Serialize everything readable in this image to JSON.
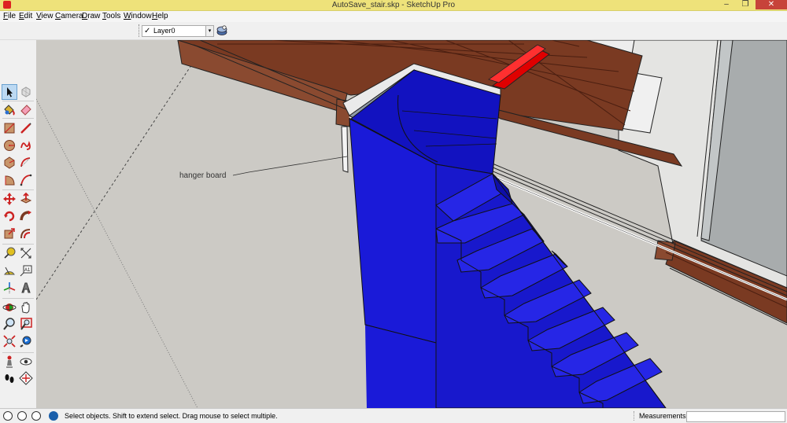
{
  "window": {
    "title": "AutoSave_stair.skp - SketchUp Pro",
    "minimize": "–",
    "maximize": "❐",
    "close": "✕"
  },
  "menu": [
    {
      "key": "F",
      "rest": "ile"
    },
    {
      "key": "E",
      "rest": "dit"
    },
    {
      "key": "V",
      "rest": "iew"
    },
    {
      "key": "C",
      "rest": "amera"
    },
    {
      "key": "D",
      "rest": "raw"
    },
    {
      "key": "T",
      "rest": "ools"
    },
    {
      "key": "W",
      "rest": "indow"
    },
    {
      "key": "H",
      "rest": "elp"
    }
  ],
  "layers": {
    "current": "Layer0",
    "check": "✓",
    "dropdown_arrow": "▾"
  },
  "tools": [
    {
      "name": "select-tool-icon",
      "selected": true
    },
    {
      "name": "make-component-icon"
    },
    {
      "name": "paint-bucket-icon"
    },
    {
      "name": "eraser-icon"
    },
    {
      "name": "rectangle-icon"
    },
    {
      "name": "line-icon"
    },
    {
      "name": "circle-icon"
    },
    {
      "name": "freehand-icon"
    },
    {
      "name": "polygon-icon"
    },
    {
      "name": "arc-icon"
    },
    {
      "name": "pie-icon"
    },
    {
      "name": "two-point-arc-icon"
    },
    {
      "name": "move-icon"
    },
    {
      "name": "push-pull-icon"
    },
    {
      "name": "rotate-icon"
    },
    {
      "name": "follow-me-icon"
    },
    {
      "name": "scale-icon"
    },
    {
      "name": "offset-icon"
    },
    {
      "name": "tape-measure-icon"
    },
    {
      "name": "dimension-icon"
    },
    {
      "name": "protractor-icon"
    },
    {
      "name": "text-icon"
    },
    {
      "name": "axes-icon"
    },
    {
      "name": "3d-text-icon"
    },
    {
      "name": "orbit-icon"
    },
    {
      "name": "pan-icon"
    },
    {
      "name": "zoom-icon"
    },
    {
      "name": "zoom-window-icon"
    },
    {
      "name": "zoom-extents-icon"
    },
    {
      "name": "previous-view-icon"
    },
    {
      "name": "position-camera-icon"
    },
    {
      "name": "look-around-icon"
    },
    {
      "name": "walk-icon"
    },
    {
      "name": "section-plane-icon"
    }
  ],
  "viewport": {
    "annotation": "hanger board",
    "colors": {
      "background": "#cccac5",
      "stair_blue": "#1010cc",
      "wood": "#7a3a22",
      "beam_red": "#e00000"
    }
  },
  "status": {
    "message": "Select objects. Shift to extend select. Drag mouse to select multiple.",
    "measurements_label": "Measurements",
    "measurements_value": ""
  }
}
